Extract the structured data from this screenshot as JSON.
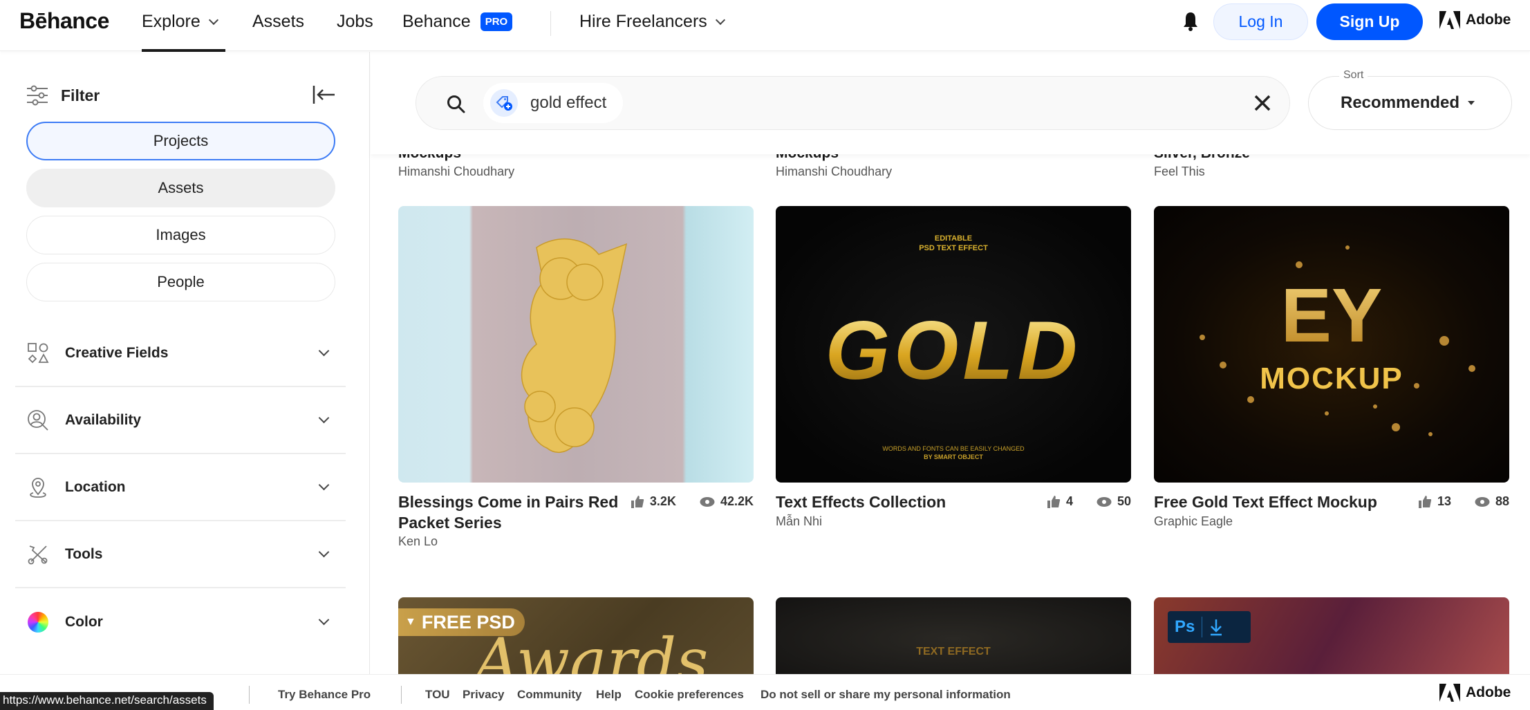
{
  "header": {
    "logo": "Bēhance",
    "nav": [
      {
        "label": "Explore",
        "dropdown": true,
        "active": true
      },
      {
        "label": "Assets"
      },
      {
        "label": "Jobs"
      },
      {
        "label": "Behance",
        "badge": "PRO"
      },
      {
        "label": "Hire Freelancers",
        "dropdown": true
      }
    ],
    "login": "Log In",
    "signup": "Sign Up",
    "adobe": "Adobe",
    "icons": {
      "notifications": "bell-icon"
    }
  },
  "sidebar": {
    "filter_label": "Filter",
    "types": [
      {
        "label": "Projects",
        "state": "selected"
      },
      {
        "label": "Assets",
        "state": "hover"
      },
      {
        "label": "Images"
      },
      {
        "label": "People"
      }
    ],
    "facets": [
      {
        "label": "Creative Fields",
        "icon": "shapes-icon"
      },
      {
        "label": "Availability",
        "icon": "person-search-icon"
      },
      {
        "label": "Location",
        "icon": "location-pin-icon"
      },
      {
        "label": "Tools",
        "icon": "tools-icon"
      },
      {
        "label": "Color",
        "icon": "color-wheel-icon"
      }
    ]
  },
  "search": {
    "query": "gold effect",
    "sort_label": "Sort",
    "sort_value": "Recommended"
  },
  "partial_row": [
    {
      "title": "Mockups",
      "owner": "Himanshi Choudhary"
    },
    {
      "title": "Mockups",
      "owner": "Himanshi Choudhary"
    },
    {
      "title": "Silver, Bronze",
      "owner": "Feel This"
    }
  ],
  "cards": [
    {
      "title": "Blessings Come in Pairs Red Packet Series",
      "title_line1": "Blessings Come in Pairs Red",
      "title_line2": "Packet Series",
      "owner": "Ken Lo",
      "likes": "3.2K",
      "views": "42.2K"
    },
    {
      "title": "Text Effects Collection",
      "owner": "Mẫn Nhi",
      "likes": "4",
      "views": "50",
      "thumb_top": "EDITABLE",
      "thumb_top2": "PSD TEXT EFFECT",
      "thumb_main": "GOLD",
      "thumb_bottom": "WORDS AND FONTS CAN BE EASILY CHANGED",
      "thumb_bottom2": "BY SMART OBJECT"
    },
    {
      "title": "Free Gold Text Effect Mockup",
      "owner": "Graphic Eagle",
      "likes": "13",
      "views": "88",
      "thumb_main": "EY",
      "thumb_sub": "MOCKUP"
    }
  ],
  "next_row": [
    {
      "badge": "FREE PSD",
      "thumb_text": "Awards"
    },
    {
      "thumb_text": "TEXT EFFECT"
    },
    {
      "badge_app": "Ps",
      "badge_icon": "download-icon"
    }
  ],
  "footer": {
    "status_url": "https://www.behance.net/search/assets",
    "links": [
      "Try Behance Pro",
      "TOU",
      "Privacy",
      "Community",
      "Help",
      "Cookie preferences",
      "Do not sell or share my personal information"
    ],
    "adobe": "Adobe"
  }
}
